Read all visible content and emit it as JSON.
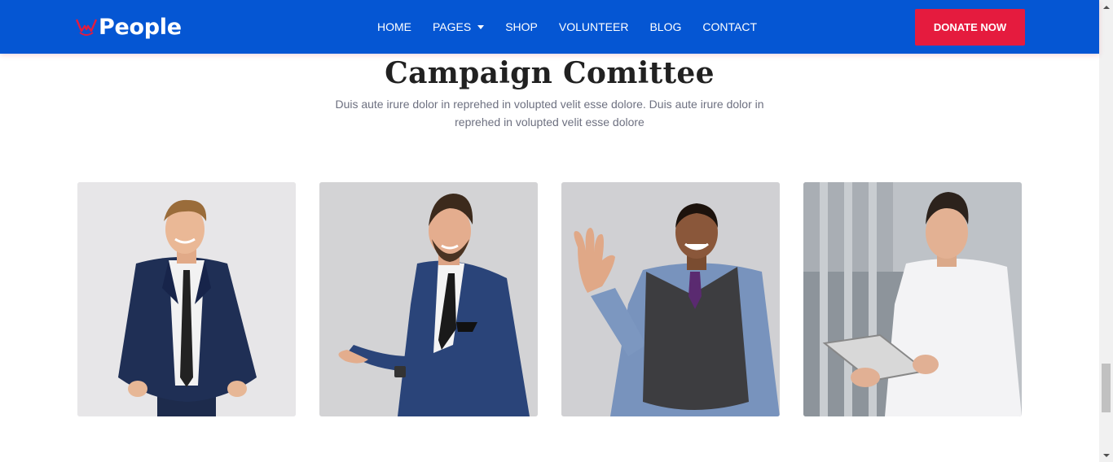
{
  "brand": {
    "name": "People",
    "icon": "people-logo-icon"
  },
  "nav": {
    "items": [
      {
        "label": "HOME",
        "has_dropdown": false
      },
      {
        "label": "PAGES",
        "has_dropdown": true
      },
      {
        "label": "SHOP",
        "has_dropdown": false
      },
      {
        "label": "VOLUNTEER",
        "has_dropdown": false
      },
      {
        "label": "BLOG",
        "has_dropdown": false
      },
      {
        "label": "CONTACT",
        "has_dropdown": false
      }
    ],
    "cta_label": "DONATE NOW"
  },
  "section": {
    "title": "Campaign Comittee",
    "description": "Duis aute irure dolor in reprehed in volupted velit esse dolore. Duis aute irure dolor in reprehed in volupted velit esse dolore"
  },
  "members": [
    {
      "photo": "man-navy-suit-hands-in-pockets"
    },
    {
      "photo": "bearded-man-blue-suit-presenting"
    },
    {
      "photo": "smiling-man-vest-waving"
    },
    {
      "photo": "man-white-shirt-holding-tablet"
    }
  ],
  "colors": {
    "header_bg": "#0556d3",
    "cta_bg": "#e51b3e",
    "title_text": "#212121",
    "body_text": "#6d7080"
  }
}
